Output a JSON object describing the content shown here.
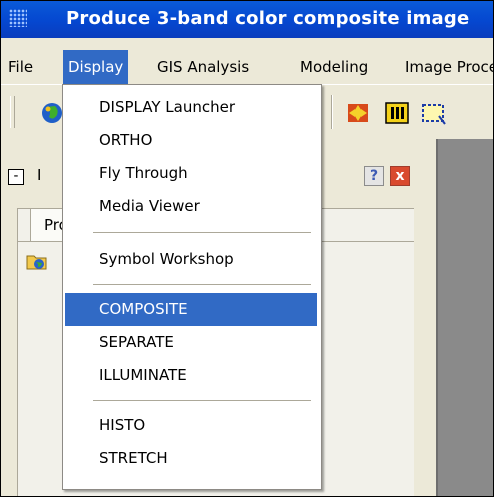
{
  "window": {
    "title": "Produce 3-band color composite image"
  },
  "menubar": {
    "items": [
      {
        "label": "File",
        "active": false
      },
      {
        "label": "Display",
        "active": true
      },
      {
        "label": "GIS Analysis",
        "active": false
      },
      {
        "label": "Modeling",
        "active": false
      },
      {
        "label": "Image Processing",
        "active": false
      }
    ]
  },
  "display_menu": {
    "items": [
      {
        "label": "DISPLAY Launcher",
        "selected": false
      },
      {
        "label": "ORTHO",
        "selected": false
      },
      {
        "label": "Fly Through",
        "selected": false
      },
      {
        "label": "Media Viewer",
        "selected": false
      },
      {
        "label": "Symbol Workshop",
        "selected": false
      },
      {
        "label": "COMPOSITE",
        "selected": true
      },
      {
        "label": "SEPARATE",
        "selected": false
      },
      {
        "label": "ILLUMINATE",
        "selected": false
      },
      {
        "label": "HISTO",
        "selected": false
      },
      {
        "label": "STRETCH",
        "selected": false
      }
    ]
  },
  "explorer_panel": {
    "title_fragment": "I",
    "tab_label": "Projects",
    "help_icon": "?",
    "close_icon": "x",
    "minimize_symbol": "-"
  },
  "colors": {
    "titlebar": "#0a4fd6",
    "selection": "#316ac5",
    "menubar": "#ece9d8",
    "canvas": "#8a8a8a"
  },
  "icons": [
    "app-grid-icon",
    "globe-icon",
    "move-arrows-icon",
    "composite-bars-icon",
    "dashed-selection-icon",
    "project-folder-icon"
  ]
}
